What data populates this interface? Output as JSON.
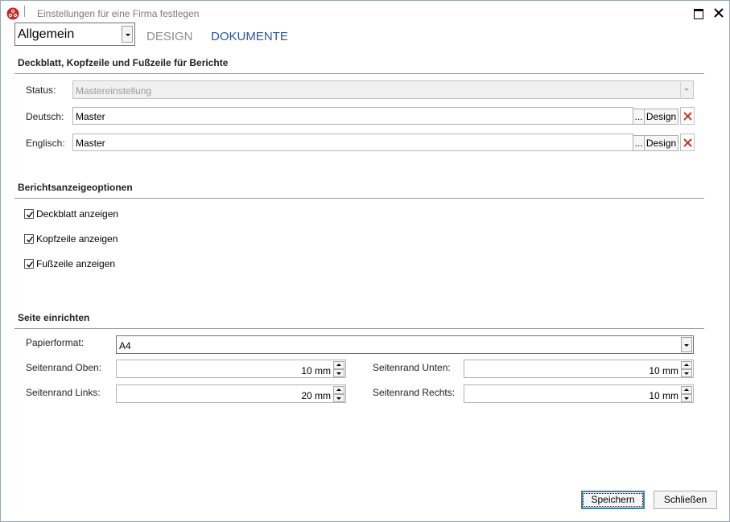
{
  "window": {
    "title": "Einstellungen für eine Firma festlegen"
  },
  "nav": {
    "category": "Allgemein",
    "tabs": [
      "DESIGN",
      "DOKUMENTE"
    ]
  },
  "cover": {
    "section_title": "Deckblatt, Kopfzeile und Fußzeile für Berichte",
    "status_label": "Status:",
    "status_value": "Mastereinstellung",
    "deutsch_label": "Deutsch:",
    "deutsch_value": "Master",
    "englisch_label": "Englisch:",
    "englisch_value": "Master",
    "browse_label": "...",
    "design_label": "Design"
  },
  "report_options": {
    "section_title": "Berichtsanzeigeoptionen",
    "items": [
      {
        "label": "Deckblatt anzeigen",
        "checked": true
      },
      {
        "label": "Kopfzeile anzeigen",
        "checked": true
      },
      {
        "label": "Fußzeile anzeigen",
        "checked": true
      }
    ]
  },
  "page_setup": {
    "section_title": "Seite einrichten",
    "paper_label": "Papierformat:",
    "paper_value": "A4",
    "margin_top_label": "Seitenrand Oben:",
    "margin_top_value": "10 mm",
    "margin_bottom_label": "Seitenrand Unten:",
    "margin_bottom_value": "10 mm",
    "margin_left_label": "Seitenrand Links:",
    "margin_left_value": "20 mm",
    "margin_right_label": "Seitenrand Rechts:",
    "margin_right_value": "10 mm"
  },
  "footer": {
    "save_label": "Speichern",
    "close_label": "Schließen"
  },
  "colors": {
    "accent": "#2b5797",
    "delete": "#c0392b"
  }
}
